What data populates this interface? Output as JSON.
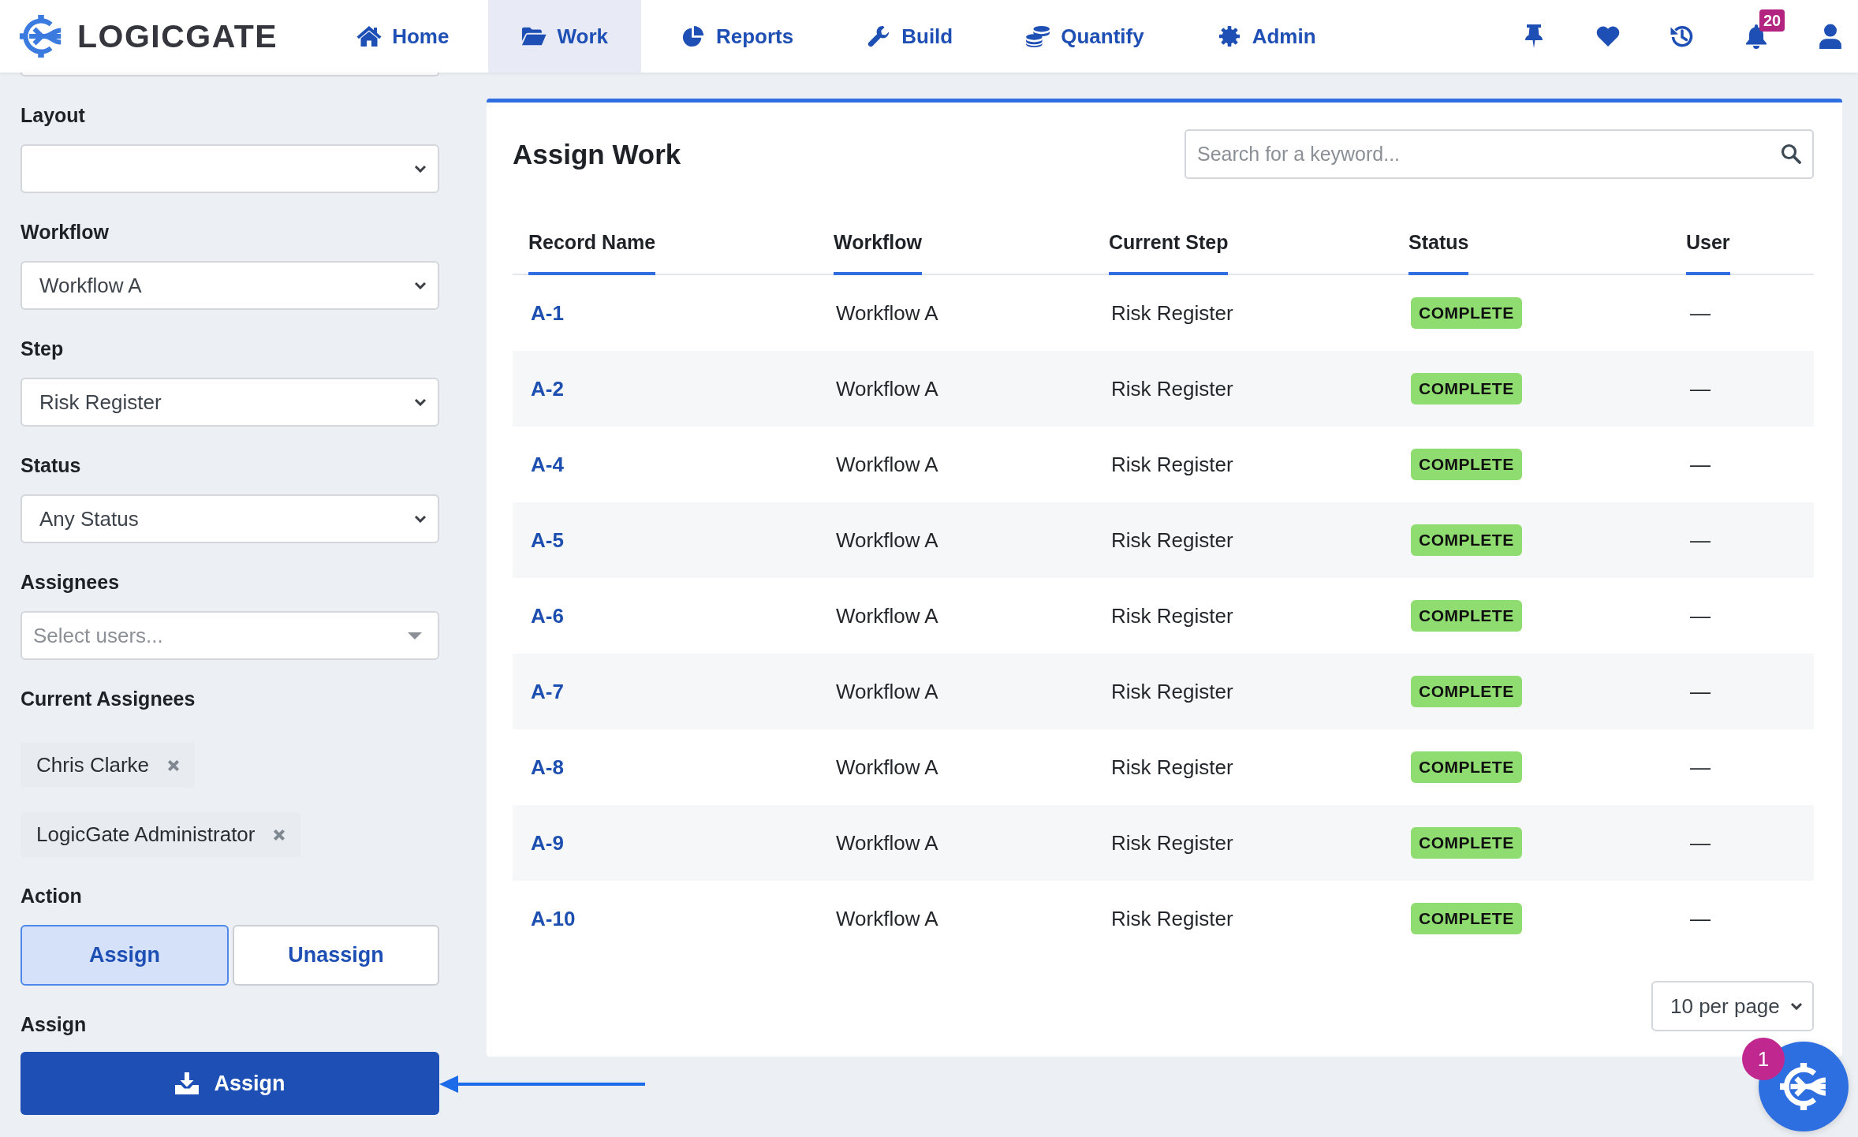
{
  "header": {
    "logo": "LOGICGATE",
    "nav": [
      {
        "kind": "home",
        "label": "Home",
        "selected": false
      },
      {
        "kind": "folder",
        "label": "Work",
        "selected": true
      },
      {
        "kind": "chart",
        "label": "Reports",
        "selected": false
      },
      {
        "kind": "wrench",
        "label": "Build",
        "selected": false
      },
      {
        "kind": "coins",
        "label": "Quantify",
        "selected": false
      },
      {
        "kind": "gear",
        "label": "Admin",
        "selected": false
      }
    ],
    "notifications": "20"
  },
  "sidebar": {
    "fields": [
      {
        "kind": "select",
        "label": "Layout"
      },
      {
        "kind": "select",
        "label": "Workflow",
        "value": "Workflow A"
      },
      {
        "kind": "select",
        "label": "Step",
        "value": "Risk Register"
      },
      {
        "kind": "select",
        "label": "Status",
        "value": "Any Status"
      },
      {
        "kind": "multiselect",
        "label": "Assignees",
        "placeholder": "Select users..."
      }
    ],
    "current_assignees": {
      "label": "Current Assignees",
      "items": [
        {
          "name": "Chris Clarke"
        },
        {
          "name": "LogicGate Administrator"
        }
      ]
    },
    "action": {
      "label": "Action",
      "options": [
        {
          "label": "Assign",
          "selected": true
        },
        {
          "label": "Unassign",
          "selected": false
        }
      ]
    },
    "submit": {
      "label": "Assign",
      "button": "Assign"
    }
  },
  "main": {
    "title": "Assign Work",
    "search": {
      "placeholder": "Search for a keyword..."
    },
    "table": {
      "columns": [
        "Record Name",
        "Workflow",
        "Current Step",
        "Status",
        "User"
      ],
      "rows": [
        {
          "record": "A-1",
          "workflow": "Workflow A",
          "step": "Risk Register",
          "status": "COMPLETE",
          "user": "—"
        },
        {
          "record": "A-2",
          "workflow": "Workflow A",
          "step": "Risk Register",
          "status": "COMPLETE",
          "user": "—"
        },
        {
          "record": "A-4",
          "workflow": "Workflow A",
          "step": "Risk Register",
          "status": "COMPLETE",
          "user": "—"
        },
        {
          "record": "A-5",
          "workflow": "Workflow A",
          "step": "Risk Register",
          "status": "COMPLETE",
          "user": "—"
        },
        {
          "record": "A-6",
          "workflow": "Workflow A",
          "step": "Risk Register",
          "status": "COMPLETE",
          "user": "—"
        },
        {
          "record": "A-7",
          "workflow": "Workflow A",
          "step": "Risk Register",
          "status": "COMPLETE",
          "user": "—"
        },
        {
          "record": "A-8",
          "workflow": "Workflow A",
          "step": "Risk Register",
          "status": "COMPLETE",
          "user": "—"
        },
        {
          "record": "A-9",
          "workflow": "Workflow A",
          "step": "Risk Register",
          "status": "COMPLETE",
          "user": "—"
        },
        {
          "record": "A-10",
          "workflow": "Workflow A",
          "step": "Risk Register",
          "status": "COMPLETE",
          "user": "—"
        }
      ]
    },
    "page_size": "10 per page"
  },
  "chat": {
    "badge": "1"
  }
}
